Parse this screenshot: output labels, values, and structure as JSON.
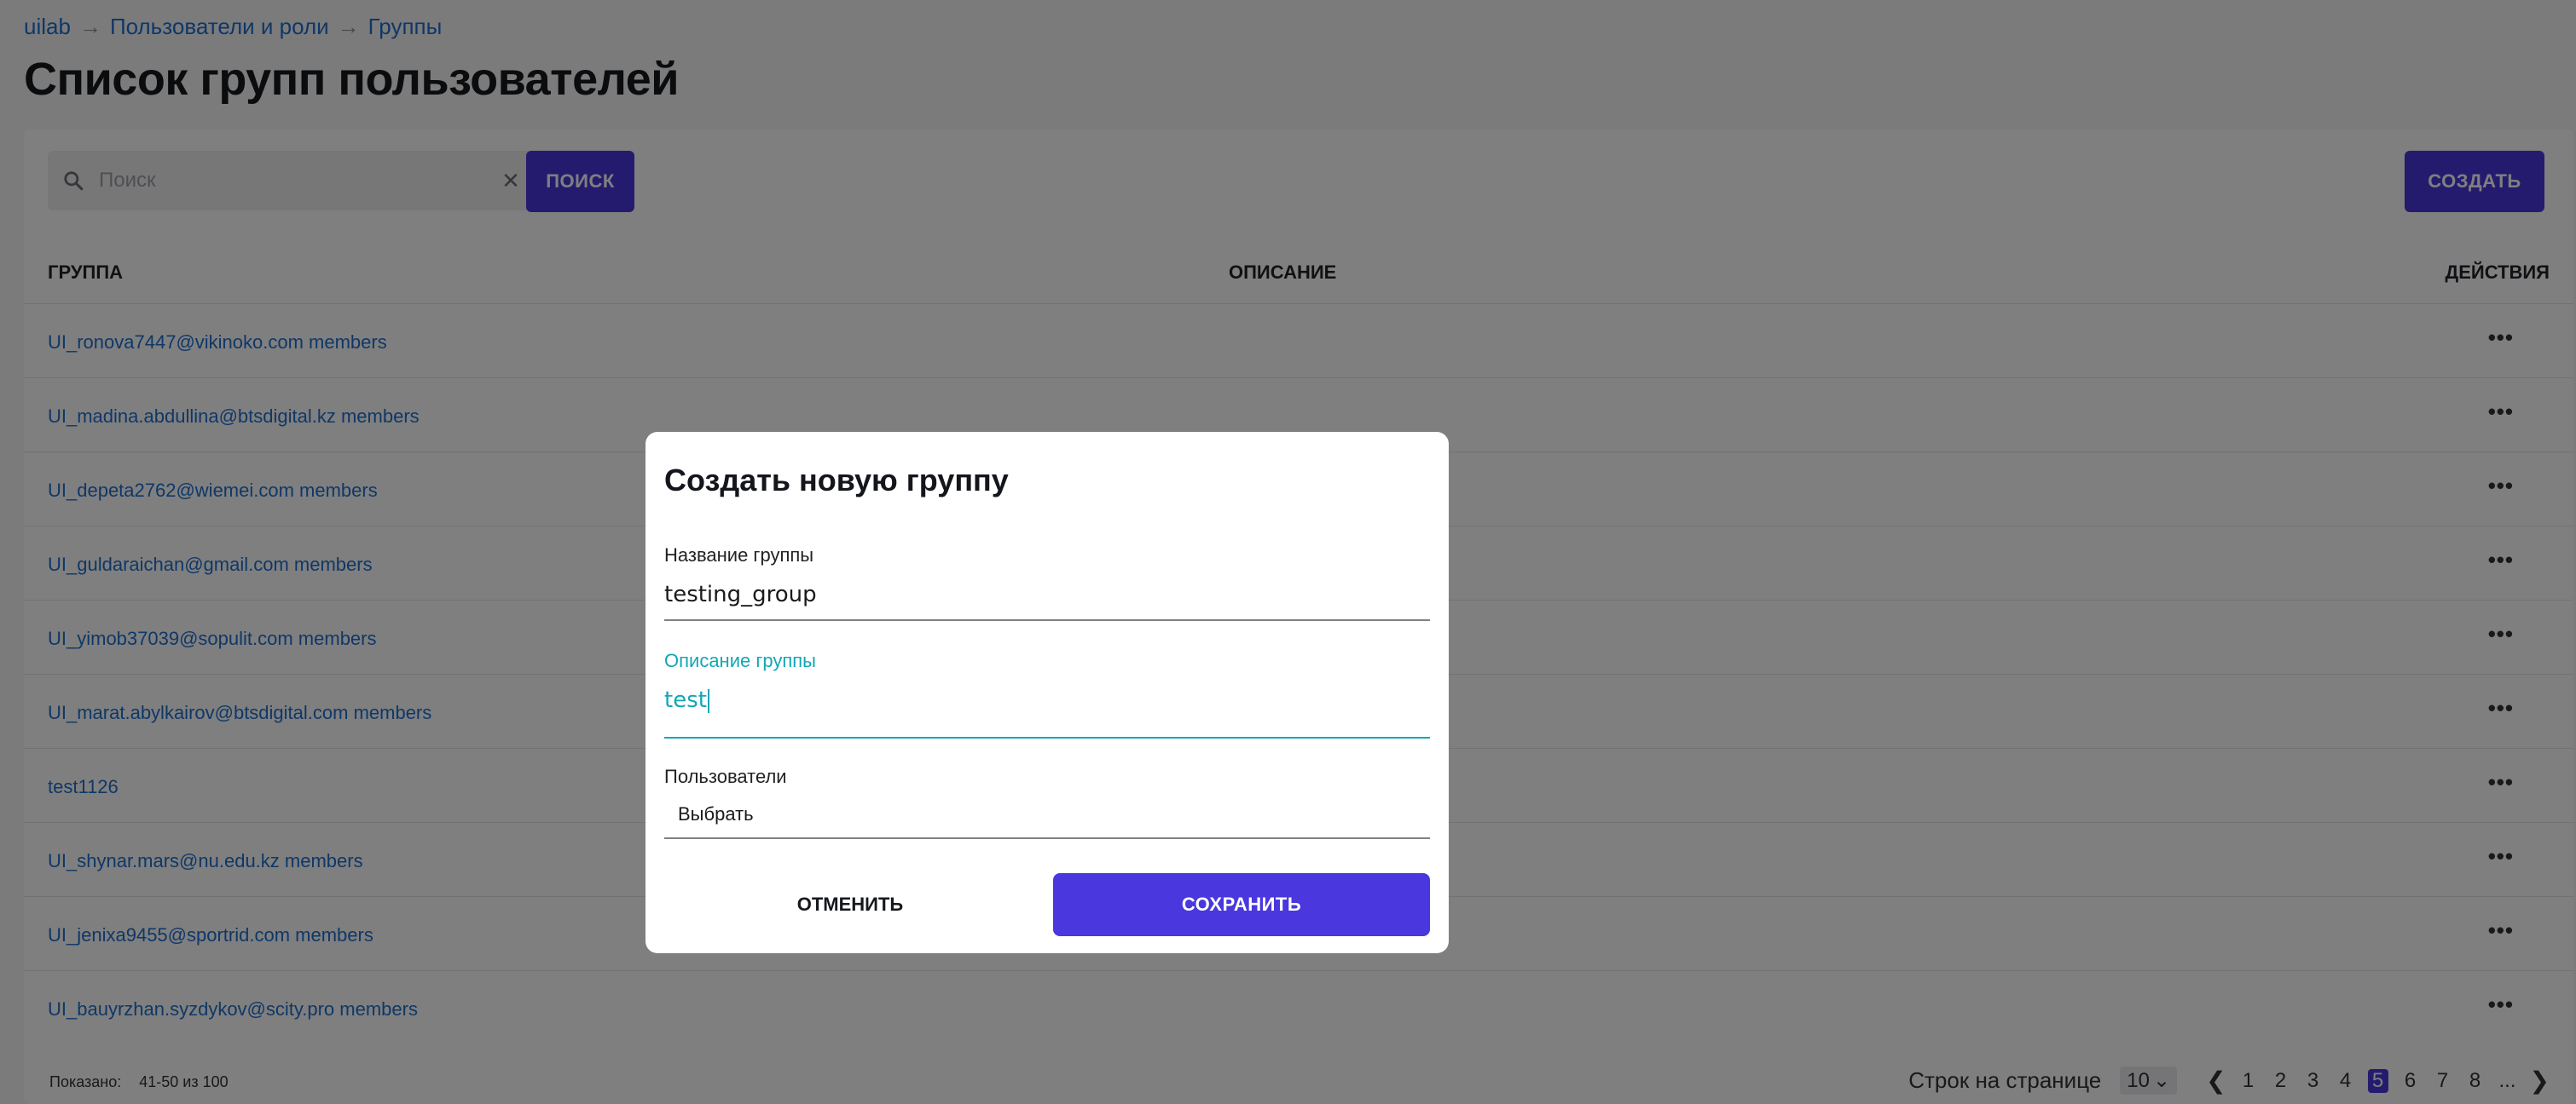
{
  "breadcrumb": [
    "uilab",
    "Пользователи и роли",
    "Группы"
  ],
  "page_title": "Список групп пользователей",
  "search": {
    "placeholder": "Поиск",
    "button": "ПОИСК",
    "clear_icon": "close-icon",
    "icon": "search-icon"
  },
  "create_button": "СОЗДАТЬ",
  "table": {
    "headers": [
      "ГРУППА",
      "ОПИСАНИЕ",
      "ДЕЙСТВИЯ"
    ],
    "rows": [
      "UI_ronova7447@vikinoko.com members",
      "UI_madina.abdullina@btsdigital.kz members",
      "UI_depeta2762@wiemei.com members",
      "UI_guldaraichan@gmail.com members",
      "UI_yimob37039@sopulit.com members",
      "UI_marat.abylkairov@btsdigital.com members",
      "test1126",
      "UI_shynar.mars@nu.edu.kz members",
      "UI_jenixa9455@sportrid.com members",
      "UI_bauyrzhan.syzdykov@scity.pro members"
    ],
    "action_icon": "more-horizontal-icon"
  },
  "footer": {
    "shown_label": "Показано:",
    "shown_range": "41-50 из 100",
    "rows_per_page_label": "Строк на странице",
    "rows_per_page": "10",
    "pages": [
      "1",
      "2",
      "3",
      "4",
      "5",
      "6",
      "7",
      "8",
      "..."
    ],
    "current_page": "5"
  },
  "modal": {
    "title": "Создать новую группу",
    "name_label": "Название группы",
    "name_value": "testing_group",
    "description_label": "Описание группы",
    "description_value": "test",
    "users_label": "Пользователи",
    "users_value": "Выбрать",
    "cancel": "ОТМЕНИТЬ",
    "save": "СОХРАНИТЬ"
  },
  "colors": {
    "accent": "#4a37dd",
    "link": "#1f6fcf",
    "focus": "#12a7b5"
  }
}
